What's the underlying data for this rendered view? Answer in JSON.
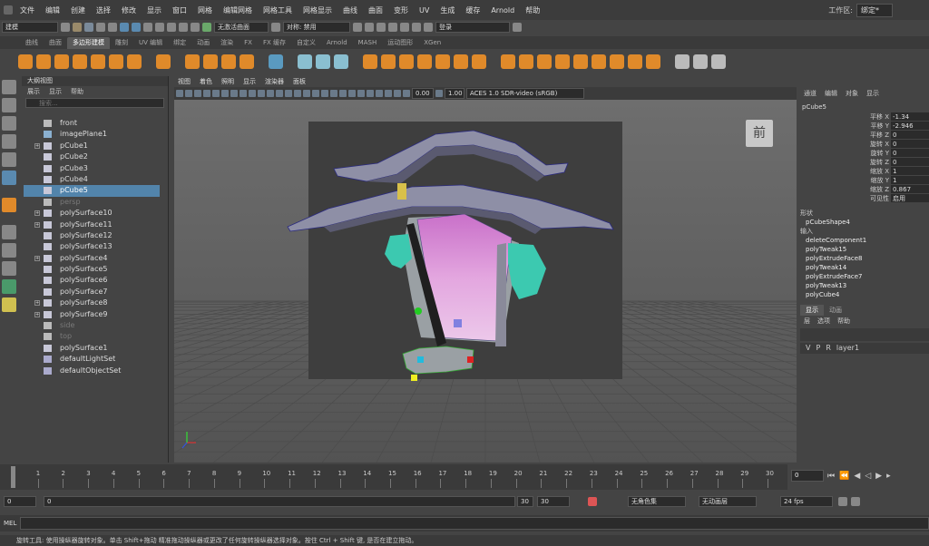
{
  "menubar": {
    "items": [
      "文件",
      "编辑",
      "创建",
      "选择",
      "修改",
      "显示",
      "窗口",
      "网格",
      "编辑网格",
      "网格工具",
      "网格显示",
      "曲线",
      "曲面",
      "变形",
      "UV",
      "生成",
      "缓存",
      "Arnold",
      "帮助"
    ],
    "workspace_label": "工作区:",
    "workspace_value": "绑定*"
  },
  "statusline": {
    "mode": "建模",
    "live_surface": "无激活曲面",
    "symmetry": "对称: 禁用",
    "login": "登录"
  },
  "shelf_tabs": [
    "曲线",
    "曲面",
    "多边形建模",
    "雕刻",
    "UV 编辑",
    "绑定",
    "动画",
    "渲染",
    "FX",
    "FX 缓存",
    "自定义",
    "Arnold",
    "MASH",
    "运动图形",
    "XGen"
  ],
  "shelf_active": "多边形建模",
  "outliner": {
    "title": "大纲视图",
    "menus": [
      "展示",
      "显示",
      "帮助"
    ],
    "search_placeholder": "搜索...",
    "items": [
      {
        "label": "front",
        "type": "camera",
        "state": "normal"
      },
      {
        "label": "imagePlane1",
        "type": "image",
        "state": "normal"
      },
      {
        "label": "pCube1",
        "type": "mesh",
        "state": "expandable"
      },
      {
        "label": "pCube2",
        "type": "mesh",
        "state": "normal"
      },
      {
        "label": "pCube3",
        "type": "mesh",
        "state": "normal"
      },
      {
        "label": "pCube4",
        "type": "mesh",
        "state": "normal"
      },
      {
        "label": "pCube5",
        "type": "mesh",
        "state": "selected"
      },
      {
        "label": "persp",
        "type": "camera",
        "state": "dim"
      },
      {
        "label": "polySurface10",
        "type": "mesh",
        "state": "expandable"
      },
      {
        "label": "polySurface11",
        "type": "mesh",
        "state": "expandable"
      },
      {
        "label": "polySurface12",
        "type": "mesh",
        "state": "normal"
      },
      {
        "label": "polySurface13",
        "type": "mesh",
        "state": "normal"
      },
      {
        "label": "polySurface4",
        "type": "mesh",
        "state": "expandable"
      },
      {
        "label": "polySurface5",
        "type": "mesh",
        "state": "normal"
      },
      {
        "label": "polySurface6",
        "type": "mesh",
        "state": "normal"
      },
      {
        "label": "polySurface7",
        "type": "mesh",
        "state": "normal"
      },
      {
        "label": "polySurface8",
        "type": "mesh",
        "state": "expandable"
      },
      {
        "label": "polySurface9",
        "type": "mesh",
        "state": "expandable"
      },
      {
        "label": "side",
        "type": "camera",
        "state": "dim"
      },
      {
        "label": "top",
        "type": "camera",
        "state": "dim"
      },
      {
        "label": "polySurface1",
        "type": "mesh",
        "state": "normal"
      },
      {
        "label": "defaultLightSet",
        "type": "set",
        "state": "normal"
      },
      {
        "label": "defaultObjectSet",
        "type": "set",
        "state": "normal"
      }
    ]
  },
  "viewport": {
    "menus": [
      "视图",
      "着色",
      "照明",
      "显示",
      "渲染器",
      "面板"
    ],
    "gamma": "0.00",
    "exposure": "1.00",
    "colorspace": "ACES 1.0 SDR-video (sRGB)",
    "view_cube_label": "前"
  },
  "channel_box": {
    "tabs": [
      "通道",
      "编辑",
      "对象",
      "显示"
    ],
    "object": "pCube5",
    "attributes": [
      {
        "name": "平移 X",
        "value": "-1.34"
      },
      {
        "name": "平移 Y",
        "value": "-2.946"
      },
      {
        "name": "平移 Z",
        "value": "0"
      },
      {
        "name": "旋转 X",
        "value": "0"
      },
      {
        "name": "旋转 Y",
        "value": "0"
      },
      {
        "name": "旋转 Z",
        "value": "0"
      },
      {
        "name": "缩放 X",
        "value": "1"
      },
      {
        "name": "缩放 Y",
        "value": "1"
      },
      {
        "name": "缩放 Z",
        "value": "0.867"
      },
      {
        "name": "可见性",
        "value": "启用"
      }
    ],
    "shapes_header": "形状",
    "shape": "pCubeShape4",
    "inputs_header": "输入",
    "inputs": [
      "deleteComponent1",
      "polyTweak15",
      "polyExtrudeFace8",
      "polyTweak14",
      "polyExtrudeFace7",
      "polyTweak13",
      "polyCube4"
    ]
  },
  "layer_editor": {
    "tabs": [
      "显示",
      "动画"
    ],
    "menus": [
      "层",
      "选项",
      "帮助"
    ],
    "layer": {
      "v": "V",
      "p": "P",
      "r": "R",
      "name": "layer1"
    }
  },
  "timeline": {
    "ticks": [
      "0",
      "1",
      "2",
      "3",
      "4",
      "5",
      "6",
      "7",
      "8",
      "9",
      "10",
      "11",
      "12",
      "13",
      "14",
      "15",
      "16",
      "17",
      "18",
      "19",
      "20",
      "21",
      "22",
      "23",
      "24",
      "25",
      "26",
      "27",
      "28",
      "29",
      "30"
    ],
    "current_frame": "0"
  },
  "range": {
    "start": "0",
    "inner_start": "0",
    "inner_end": "30",
    "end": "30",
    "character_set": "无角色集",
    "anim_layer": "无动画层",
    "fps": "24 fps"
  },
  "mel": {
    "label": "MEL"
  },
  "help_line": "旋转工具: 使用操纵器旋转对象。单击 Shift+拖动 精准拖动操纵器或更改了任何旋转操纵器选择对象。按住 Ctrl + Shift 键, 是否在建立拖动。"
}
